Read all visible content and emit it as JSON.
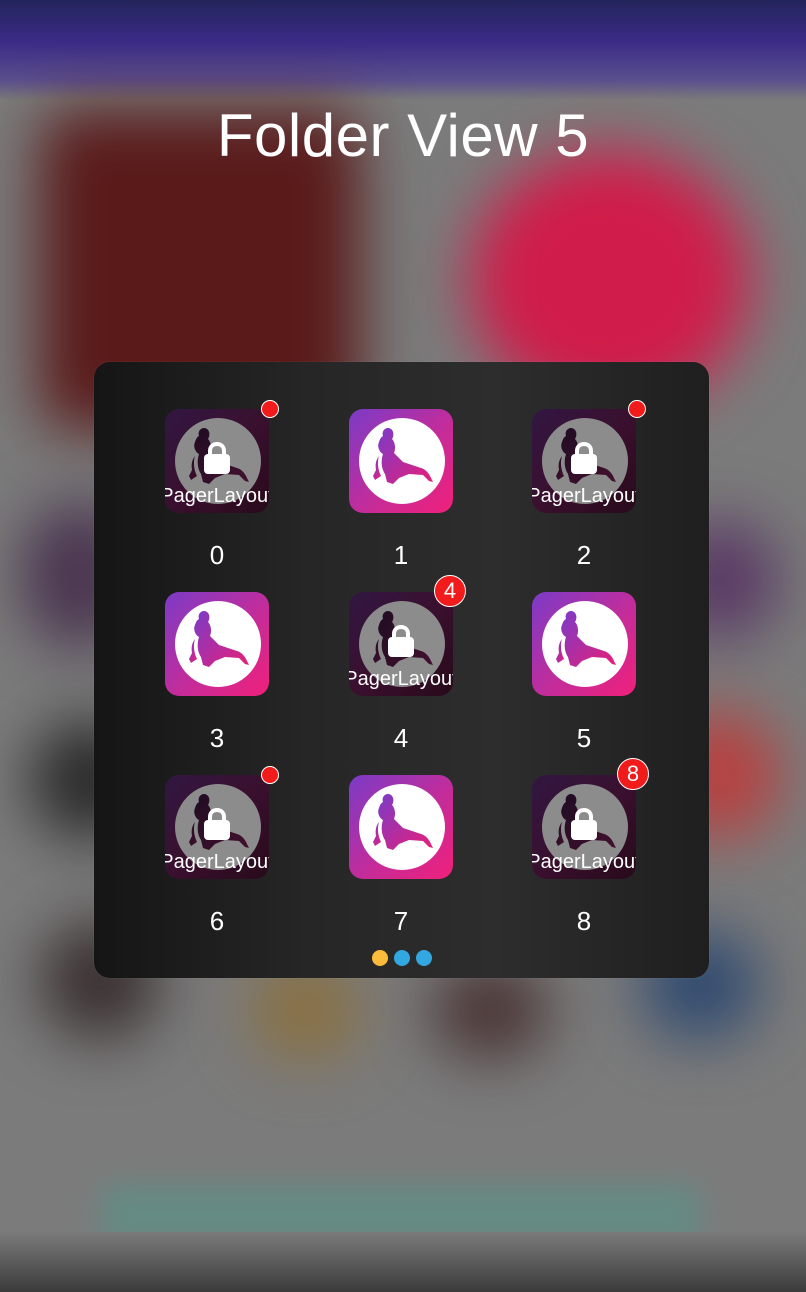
{
  "title": "Folder View 5",
  "items": [
    {
      "label": "0",
      "type": "locked",
      "overlay_text": "PagerLayout",
      "badge": "dot"
    },
    {
      "label": "1",
      "type": "app"
    },
    {
      "label": "2",
      "type": "locked",
      "overlay_text": "PagerLayout",
      "badge": "dot"
    },
    {
      "label": "3",
      "type": "app"
    },
    {
      "label": "4",
      "type": "locked",
      "overlay_text": "PagerLayout",
      "badge": "4"
    },
    {
      "label": "5",
      "type": "app"
    },
    {
      "label": "6",
      "type": "locked",
      "overlay_text": "PagerLayout",
      "badge": "dot"
    },
    {
      "label": "7",
      "type": "app"
    },
    {
      "label": "8",
      "type": "locked",
      "overlay_text": "PagerLayout",
      "badge": "8"
    }
  ],
  "page_indicator": {
    "count": 3,
    "active_index": 0,
    "active_color": "#fbbc3b",
    "inactive_color": "#33a7e0"
  },
  "icons": {
    "app_icon": "silhouette-app-icon",
    "lock_icon": "lock-icon"
  }
}
